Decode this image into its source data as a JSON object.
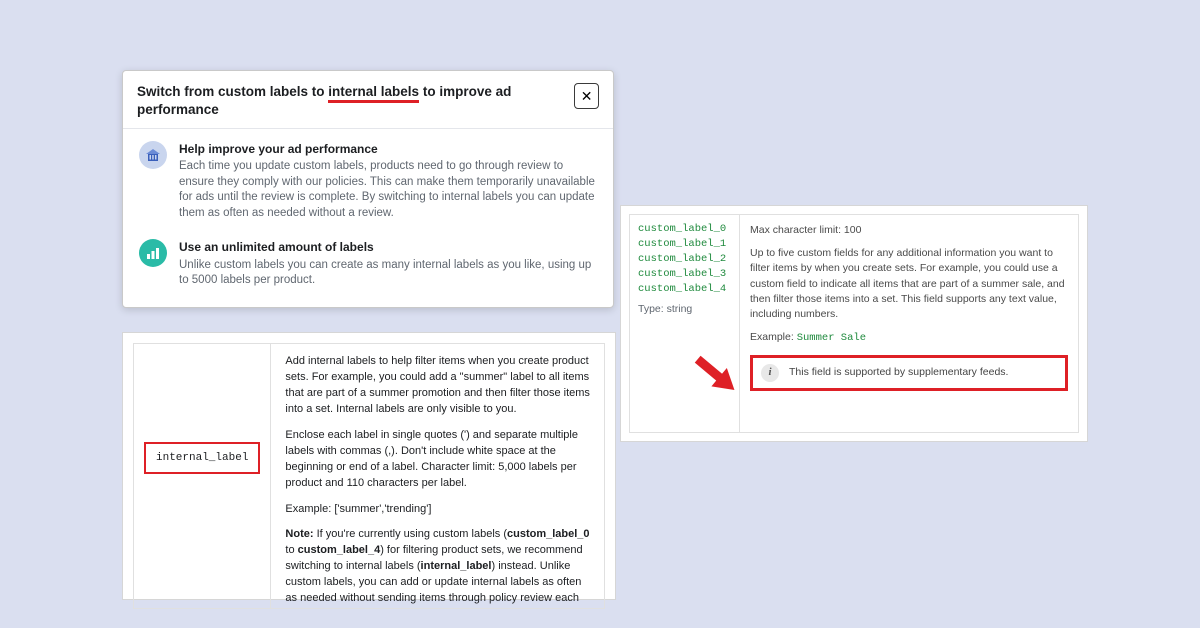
{
  "dialog": {
    "title_prefix": "Switch from custom labels to ",
    "title_highlight": "internal labels",
    "title_suffix": " to improve ad performance",
    "close_label": "✕",
    "rows": [
      {
        "heading": "Help improve your ad performance",
        "body": "Each time you update custom labels, products need to go through review to ensure they comply with our policies. This can make them temporarily unavailable for ads until the review is complete. By switching to internal labels you can update them as often as needed without a review."
      },
      {
        "heading": "Use an unlimited amount of labels",
        "body": "Unlike custom labels you can create as many internal labels as you like, using up to 5000 labels per product."
      }
    ]
  },
  "docs": {
    "field_name": "internal_label",
    "p1": "Add internal labels to help filter items when you create product sets. For example, you could add a \"summer\" label to all items that are part of a summer promotion and then filter those items into a set. Internal labels are only visible to you.",
    "p2": "Enclose each label in single quotes (') and separate multiple labels with commas (,). Don't include white space at the beginning or end of a label. Character limit: 5,000 labels per product and 110 characters per label.",
    "example_label": "Example: ['summer','trending']",
    "note_label": "Note:",
    "note_body_a": " If you're currently using custom labels (",
    "note_clabel0": "custom_label_0",
    "note_body_b": " to ",
    "note_clabel4": "custom_label_4",
    "note_body_c": ") for filtering product sets, we recommend switching to internal labels (",
    "note_internal": "internal_label",
    "note_body_d": ") instead. Unlike custom labels, you can add or update internal labels as often as needed without sending items through policy review each time, which can impact ad delivery."
  },
  "rpanel": {
    "labels": [
      "custom_label_0",
      "custom_label_1",
      "custom_label_2",
      "custom_label_3",
      "custom_label_4"
    ],
    "type_line": "Type: string",
    "limit_line": "Max character limit: 100",
    "desc": "Up to five custom fields for any additional information you want to filter items by when you create sets. For example, you could use a custom field to indicate all items that are part of a summer sale, and then filter those items into a set. This field supports any text value, including numbers.",
    "example_label": "Example: ",
    "example_value": "Summer Sale",
    "callout": "This field is supported by supplementary feeds."
  }
}
